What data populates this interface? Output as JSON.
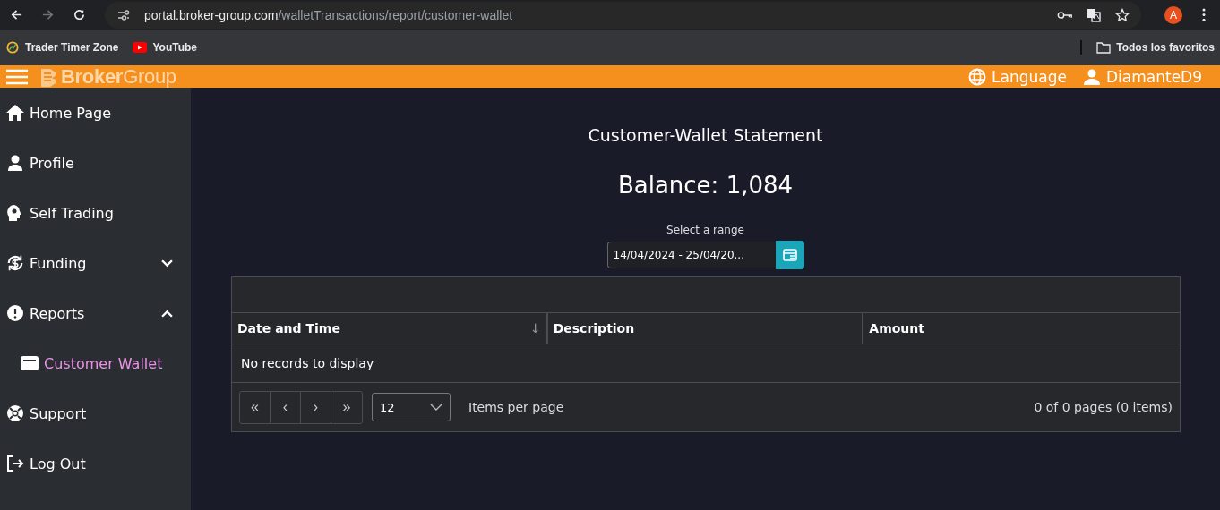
{
  "browser": {
    "url_host": "portal.broker-group.com",
    "url_path": "/walletTransactions/report/customer-wallet",
    "profile_initial": "A",
    "bookmarks": [
      "Trader Timer Zone",
      "YouTube"
    ],
    "all_bookmarks": "Todos los favoritos"
  },
  "header": {
    "logo_bold": "Broker",
    "logo_light": "Group",
    "language": "Language",
    "user": "DiamanteD9"
  },
  "sidebar": {
    "items": [
      {
        "label": "Home Page",
        "selected": false
      },
      {
        "label": "Profile",
        "selected": false
      },
      {
        "label": "Self Trading",
        "selected": false
      },
      {
        "label": "Funding",
        "selected": false,
        "expanded": false
      },
      {
        "label": "Reports",
        "selected": false,
        "expanded": true,
        "children": [
          {
            "label": "Customer Wallet",
            "selected": true
          }
        ]
      },
      {
        "label": "Support",
        "selected": false
      },
      {
        "label": "Log Out",
        "selected": false
      }
    ]
  },
  "main": {
    "title": "Customer-Wallet Statement",
    "balance": "Balance: 1,084",
    "range_label": "Select a range",
    "range_value": "14/04/2024 - 25/04/20..."
  },
  "table": {
    "columns": [
      {
        "label": "Date and Time",
        "sort": "↓"
      },
      {
        "label": "Description"
      },
      {
        "label": "Amount"
      }
    ],
    "empty_message": "No records to display",
    "pager": {
      "buttons": [
        "«",
        "‹",
        "›",
        "»"
      ],
      "page_size": "12",
      "page_size_label": "Items per page",
      "summary": "0 of 0 pages (0 items)"
    }
  }
}
